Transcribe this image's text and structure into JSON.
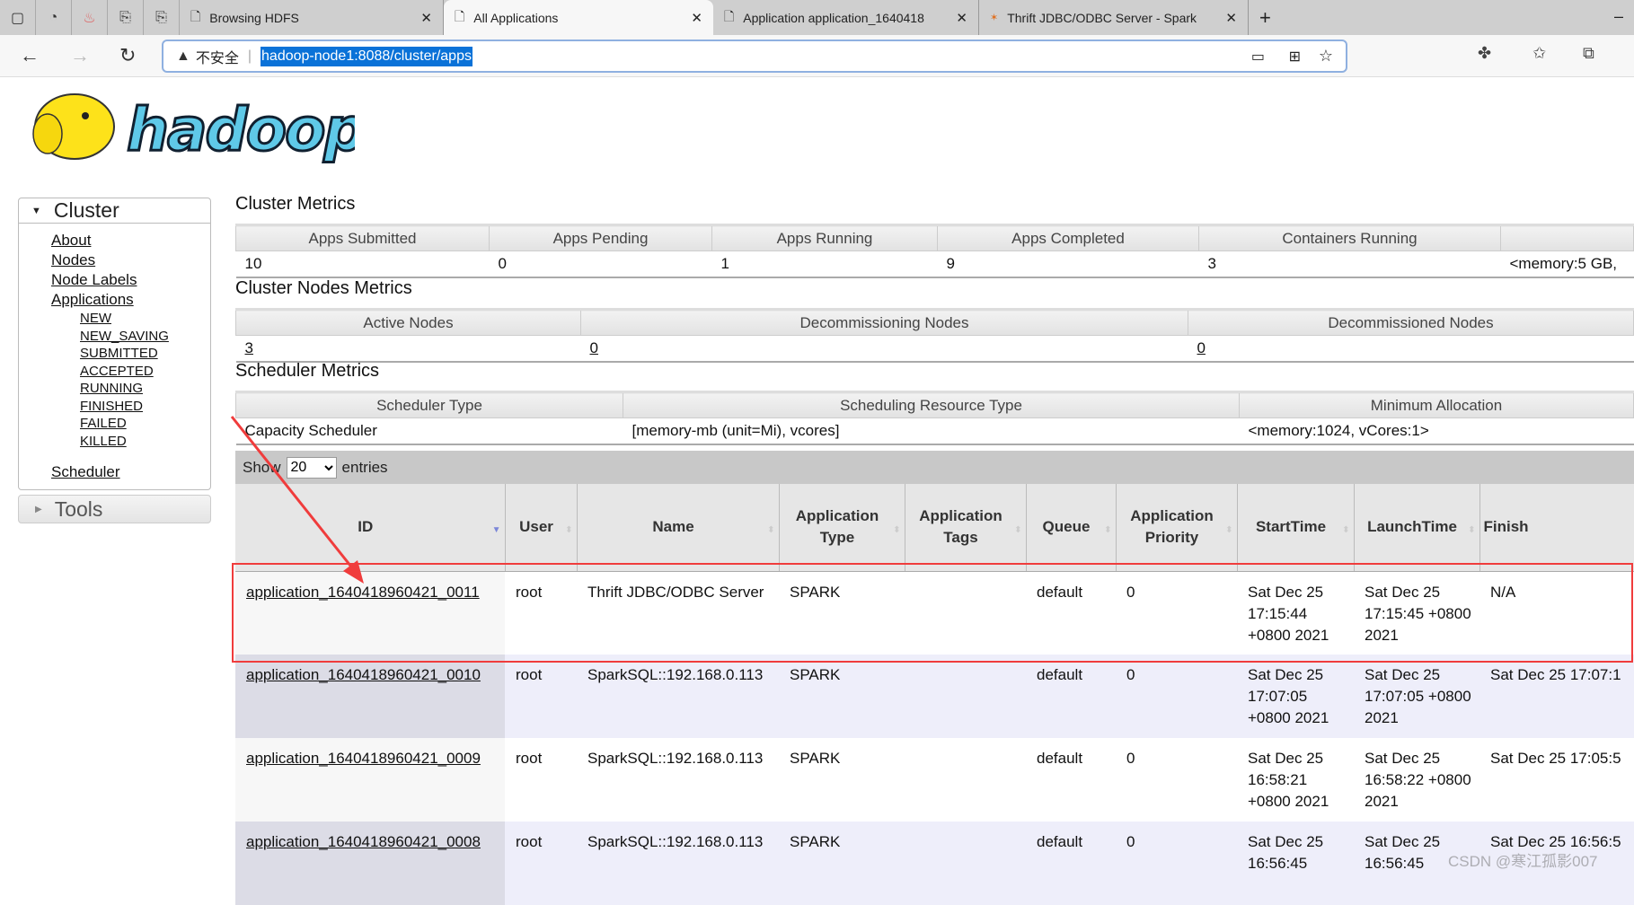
{
  "browser": {
    "tabs": [
      {
        "label": "Browsing HDFS",
        "active": false
      },
      {
        "label": "All Applications",
        "active": true
      },
      {
        "label": "Application application_1640418",
        "active": false
      },
      {
        "label": "Thrift JDBC/ODBC Server - Spark",
        "active": false
      }
    ],
    "security_label": "不安全",
    "url": "hadoop-node1:8088/cluster/apps"
  },
  "logo_text": "hadoop",
  "sidebar": {
    "cluster_label": "Cluster",
    "links": [
      "About",
      "Nodes",
      "Node Labels",
      "Applications"
    ],
    "app_states": [
      "NEW",
      "NEW_SAVING",
      "SUBMITTED",
      "ACCEPTED",
      "RUNNING",
      "FINISHED",
      "FAILED",
      "KILLED"
    ],
    "scheduler_label": "Scheduler",
    "tools_label": "Tools"
  },
  "cluster_metrics": {
    "title": "Cluster Metrics",
    "headers": [
      "Apps Submitted",
      "Apps Pending",
      "Apps Running",
      "Apps Completed",
      "Containers Running",
      ""
    ],
    "values": [
      "10",
      "0",
      "1",
      "9",
      "3",
      "<memory:5 GB,"
    ]
  },
  "nodes_metrics": {
    "title": "Cluster Nodes Metrics",
    "headers": [
      "Active Nodes",
      "Decommissioning Nodes",
      "Decommissioned Nodes"
    ],
    "values": [
      "3",
      "0",
      "0"
    ]
  },
  "scheduler_metrics": {
    "title": "Scheduler Metrics",
    "headers": [
      "Scheduler Type",
      "Scheduling Resource Type",
      "Minimum Allocation"
    ],
    "values": [
      "Capacity Scheduler",
      "[memory-mb (unit=Mi), vcores]",
      "<memory:1024, vCores:1>"
    ]
  },
  "apps": {
    "show_label": "Show",
    "entries_value": "20",
    "entries_label": "entries",
    "headers": [
      "ID",
      "User",
      "Name",
      "Application Type",
      "Application Tags",
      "Queue",
      "Application Priority",
      "StartTime",
      "LaunchTime",
      "Finish"
    ],
    "rows": [
      {
        "id": "application_1640418960421_0011",
        "user": "root",
        "name": "Thrift JDBC/ODBC Server",
        "type": "SPARK",
        "tags": "",
        "queue": "default",
        "priority": "0",
        "start": "Sat Dec 25 17:15:44 +0800 2021",
        "launch": "Sat Dec 25 17:15:45 +0800 2021",
        "finish": "N/A"
      },
      {
        "id": "application_1640418960421_0010",
        "user": "root",
        "name": "SparkSQL::192.168.0.113",
        "type": "SPARK",
        "tags": "",
        "queue": "default",
        "priority": "0",
        "start": "Sat Dec 25 17:07:05 +0800 2021",
        "launch": "Sat Dec 25 17:07:05 +0800 2021",
        "finish": "Sat Dec 25 17:07:1"
      },
      {
        "id": "application_1640418960421_0009",
        "user": "root",
        "name": "SparkSQL::192.168.0.113",
        "type": "SPARK",
        "tags": "",
        "queue": "default",
        "priority": "0",
        "start": "Sat Dec 25 16:58:21 +0800 2021",
        "launch": "Sat Dec 25 16:58:22 +0800 2021",
        "finish": "Sat Dec 25 17:05:5"
      },
      {
        "id": "application_1640418960421_0008",
        "user": "root",
        "name": "SparkSQL::192.168.0.113",
        "type": "SPARK",
        "tags": "",
        "queue": "default",
        "priority": "0",
        "start": "Sat Dec 25 16:56:45",
        "launch": "Sat Dec 25 16:56:45",
        "finish": "Sat Dec 25 16:56:5"
      }
    ]
  },
  "annotation_color": "#f03c3c",
  "watermark": "CSDN @寒江孤影007"
}
